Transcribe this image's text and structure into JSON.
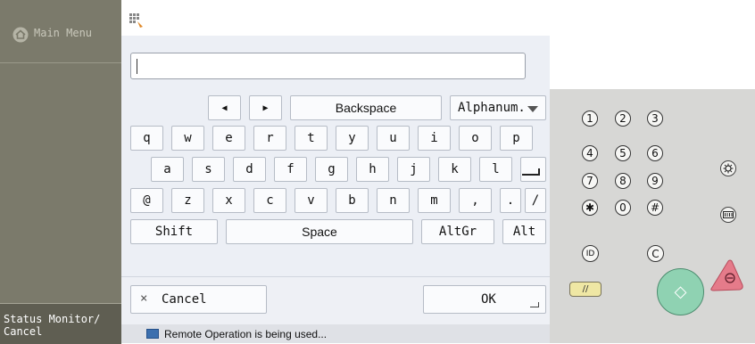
{
  "sidebar": {
    "main_menu_label": "Main Menu",
    "status_line1": "Status Monitor/",
    "status_line2": "Cancel"
  },
  "input": {
    "value": "",
    "placeholder": ""
  },
  "keyboard": {
    "nav": {
      "left_arrow": "◀",
      "right_arrow": "▶",
      "backspace": "Backspace",
      "mode": "Alphanum."
    },
    "row1": [
      "q",
      "w",
      "e",
      "r",
      "t",
      "y",
      "u",
      "i",
      "o",
      "p",
      "-"
    ],
    "row2": [
      "a",
      "s",
      "d",
      "f",
      "g",
      "h",
      "j",
      "k",
      "l"
    ],
    "row3": [
      "@",
      "z",
      "x",
      "c",
      "v",
      "b",
      "n",
      "m",
      ",",
      ".",
      "/"
    ],
    "row4": {
      "shift": "Shift",
      "space": "Space",
      "altgr": "AltGr",
      "alt": "Alt"
    }
  },
  "bottom": {
    "cancel_icon": "×",
    "cancel_label": "Cancel",
    "ok_label": "OK"
  },
  "remote_text": "Remote Operation is being used...",
  "hardware": {
    "numbers": [
      "1",
      "2",
      "3",
      "4",
      "5",
      "6",
      "7",
      "8",
      "9",
      "✱",
      "0",
      "#"
    ],
    "id_label": "ID",
    "c_label": "C",
    "clear_symbol": "//",
    "start_symbol": "◇"
  },
  "colors": {
    "sidebar": "#7b7a6b",
    "sidebar_status": "#5f5e52",
    "keyboard_bg": "#eceff5",
    "start_button": "#8fd2b2",
    "stop_button": "#e57b8a",
    "clear_button": "#efe7a4",
    "remote_icon": "#3c6fae"
  }
}
